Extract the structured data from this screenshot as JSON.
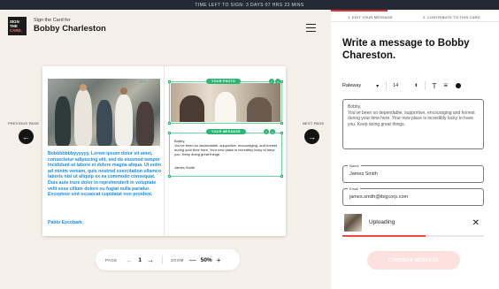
{
  "banner": {
    "text": "TIME LEFT TO SIGN: 3 DAYS 07 HRS 23 MINS"
  },
  "header": {
    "logo_lines": [
      "SIGN",
      "THE",
      "CARD."
    ],
    "subtitle": "Sign the Card for",
    "recipient": "Bobby Charleston",
    "menu_icon": "hamburger-menu-icon"
  },
  "nav": {
    "previous_label": "PREVIOUS PAGE",
    "previous_icon": "arrow-left-icon",
    "next_label": "NEXT PAGE",
    "next_icon": "arrow-right-icon"
  },
  "card": {
    "photo_tag": "JPT",
    "blue_message": "Bobbbbbbbyyyyyy, Lorem ipsum dolor sit amet, consectetur adipiscing elit, sed do eiusmod tempor incididunt ut labore et dolore magna aliqua. Ut enim ad minim veniam, quis nostrud exercitation ullamco laboris nisi ut aliquip ex ea commodo consequat. Duis aute irure dolor in reprehenderit in voluptate velit esse cillum dolore eu fugiat nulla pariatur. Excepteur sint occaecat cupidatat non proident.",
    "blue_signature": "Pablo Escobark",
    "photo_pill": "YOUR PHOTO",
    "message_pill": "YOUR MESSAGE",
    "message_greeting": "Bobby,",
    "message_body": "You've been so dependable, supportive, encouraging, and honest during your time here. Your new place is incredibly lucky to have you. Keep doing great things.",
    "message_signature": "James Smith"
  },
  "pager": {
    "page_label": "PAGE",
    "page_number": "1",
    "zoom_label": "ZOOM",
    "zoom_value": "50%",
    "minus": "—",
    "plus": "+"
  },
  "panel": {
    "tabs": [
      "1. EDIT YOUR MESSAGE",
      "2. CONTRIBUTE TO THIS CARD"
    ],
    "active_tab": 0,
    "title": "Write a message to Bobby Chareston.",
    "font_name": "Raleway",
    "font_size": "14",
    "message_text": "Bobby,\nYou've been so dependable, supportive, encouraging and honest during your time here. Your new place is incredibly lucky to have you. Keep doing great things.",
    "name_label": "Name",
    "name_value": "James Smith",
    "email_label": "Email",
    "email_value": "james.smith@ibigcorp.com",
    "upload_status": "Uploading",
    "upload_progress": 0.59,
    "continue_label": "CONTINUE MESSAGE"
  },
  "colors": {
    "accent": "#e0322e",
    "green": "#2bb673",
    "blue_text": "#1a8de6",
    "banner": "#232a33"
  }
}
